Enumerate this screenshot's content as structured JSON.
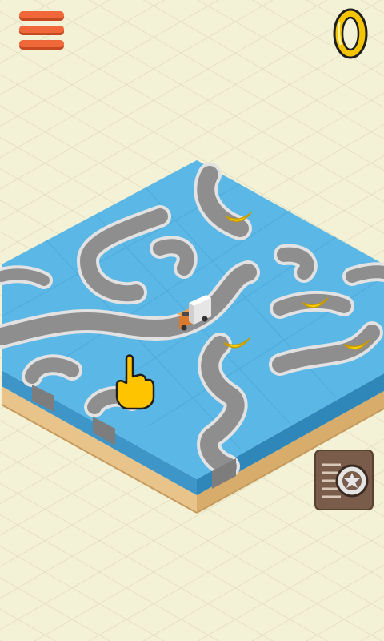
{
  "hud": {
    "menu_icon": "hamburger-menu-icon",
    "coin_icon": "gold-ring-icon",
    "coin_count": "",
    "garage_icon": "wheel-garage-icon"
  },
  "colors": {
    "background": "#f3f1d6",
    "water": "#5bb8e6",
    "water_side": "#3d95c8",
    "road": "#8e8e8e",
    "road_edge": "#d6d6d6",
    "earth_side": "#e8c48a",
    "earth_dark": "#c79a5c",
    "menu": "#f0683a",
    "coin": "#f5c400",
    "banana": "#ffd400",
    "garage_button": "#7a5c4a"
  },
  "board": {
    "collectibles": [
      "banana",
      "banana",
      "banana",
      "banana"
    ],
    "vehicle": "truck",
    "hint": "tap-hand"
  }
}
